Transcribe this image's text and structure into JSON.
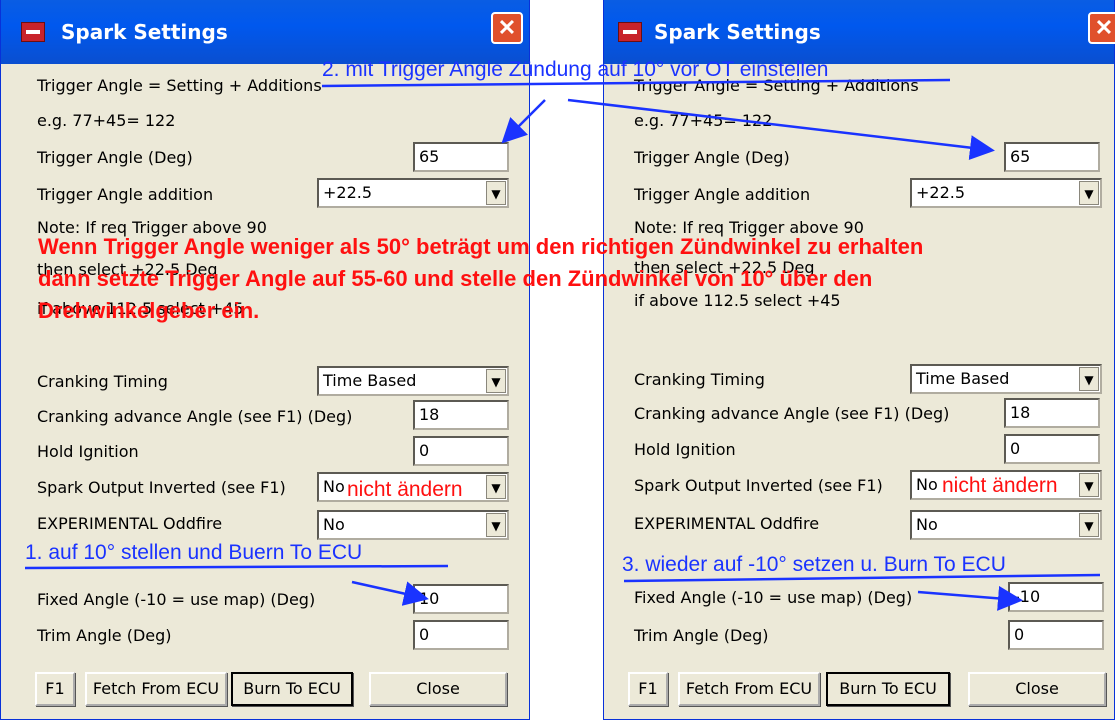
{
  "window_title": "Spark Settings",
  "close_glyph": "✕",
  "labels": {
    "formula": "Trigger Angle = Setting + Additions",
    "example": "e.g. 77+45= 122",
    "trigger_angle": "Trigger Angle  (Deg)",
    "trigger_addition": "Trigger Angle addition",
    "note1": "Note: If req Trigger above 90",
    "note2": "then select +22.5 Deg",
    "note3": "if above 112.5 select +45",
    "cranking_timing": "Cranking Timing",
    "cranking_advance": "Cranking advance Angle (see F1) (Deg)",
    "hold_ignition": "Hold Ignition",
    "spark_output": "Spark Output Inverted (see F1)",
    "oddfire": "EXPERIMENTAL Oddfire",
    "fixed_angle": "Fixed Angle (-10 = use map) (Deg)",
    "trim_angle": "Trim Angle (Deg)"
  },
  "buttons": {
    "f1": "F1",
    "fetch": "Fetch From ECU",
    "burn": "Burn To ECU",
    "close": "Close"
  },
  "left": {
    "trigger_angle": "65",
    "trigger_addition": "+22.5",
    "cranking_timing": "Time Based",
    "cranking_advance": "18",
    "hold_ignition": "0",
    "spark_output": "No",
    "oddfire": "No",
    "fixed_angle": "10",
    "trim_angle": "0"
  },
  "right": {
    "trigger_angle": "65",
    "trigger_addition": "+22.5",
    "cranking_timing": "Time Based",
    "cranking_advance": "18",
    "hold_ignition": "0",
    "spark_output": "No",
    "oddfire": "No",
    "fixed_angle": "-10",
    "trim_angle": "0"
  },
  "annotations": {
    "step2": "2. mit Trigger Angle Zündung auf 10° vor OT einstellen",
    "red_line1": "Wenn Trigger Angle weniger als 50° beträgt um den richtigen Zündwinkel zu erhalten",
    "red_line2": "dann setzte Trigger Angle auf 55-60 und stelle den Zündwinkel von 10° über den",
    "red_line3": "Drehwinkelgeber ein.",
    "nicht_aendern": "nicht ändern",
    "step1": "1. auf 10° stellen und Buern To ECU",
    "step3": "3. wieder auf -10° setzen u. Burn To ECU"
  },
  "colors": {
    "annotation_blue": "#1a33ff",
    "annotation_red": "#ff1010",
    "dialog_bg": "#ece9d8",
    "titlebar": "#0058ee"
  }
}
